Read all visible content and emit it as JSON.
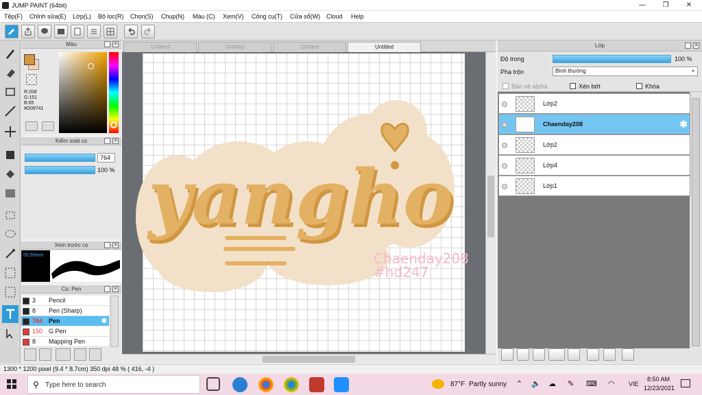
{
  "window": {
    "title": "JUMP PAINT (64bit)",
    "min": "—",
    "max": "❐",
    "close": "✕"
  },
  "menu": [
    "Tệp(F)",
    "Chỉnh sửa(E)",
    "Lớp(L)",
    "Bộ lọc(R)",
    "Chọn(S)",
    "Chụp(N)",
    "Màu (C)",
    "Xem(V)",
    "Công cụ(T)",
    "Cửa sổ(W)",
    "Cloud",
    "Help"
  ],
  "color_panel": {
    "title": "Màu",
    "r": "R:208",
    "g": "G:151",
    "b": "B:65",
    "hex": "#D09741",
    "main_color": "#d09741",
    "sub_color": "#f5d3b3"
  },
  "brush_control": {
    "title": "Kiểm soát cọ",
    "size": "764",
    "opacity": "100 %"
  },
  "preview": {
    "title": "Xem trước cọ",
    "size": "55.50mm"
  },
  "brush_list": {
    "title": "Cọ: Pen",
    "items": [
      {
        "size": "3",
        "name": "Pencil",
        "color": "#222222"
      },
      {
        "size": "8",
        "name": "Pen (Sharp)",
        "color": "#222222"
      },
      {
        "size": "764",
        "name": "Pen",
        "color": "#222222"
      },
      {
        "size": "150",
        "name": "G Pen",
        "color": "#e03a3a"
      },
      {
        "size": "8",
        "name": "Mapping Pen",
        "color": "#e03a3a"
      }
    ]
  },
  "tabs": [
    "Untitled",
    "Untitled",
    "Untitled",
    "Untitled"
  ],
  "canvas": {
    "lettering": "yangho",
    "watermark_line1": "Chaenday208",
    "watermark_line2": "#hd247"
  },
  "layer_panel": {
    "title": "Lớp",
    "opacity_label": "Độ trong",
    "opacity_value": "100 %",
    "blend_label": "Pha trộn",
    "blend_value": "Bình thường",
    "protect_alpha": "Bảo vệ alpha",
    "clip": "Xén bớt",
    "lock": "Khóa",
    "layers": [
      {
        "name": "Lớp2"
      },
      {
        "name": "Chaenday208"
      },
      {
        "name": "Lớp2"
      },
      {
        "name": "Lớp4"
      },
      {
        "name": "Lớp1"
      }
    ]
  },
  "status": {
    "size": "1300 * 1200 pixel  (9.4 * 8.7cm)  350 dpi  48 %  ( 416, -4 )"
  },
  "taskbar": {
    "search_placeholder": "Type here to search",
    "weather_temp": "87°F",
    "weather_desc": "Partly sunny",
    "lang": "VIE",
    "time": "8:50 AM",
    "date": "12/23/2021"
  },
  "colors": {
    "accent": "#2f9bd8",
    "selected_layer": "#74c6f2",
    "lettering": "#e3b163",
    "blob": "#f3e0c8",
    "watermark": "#f6b9c8"
  }
}
